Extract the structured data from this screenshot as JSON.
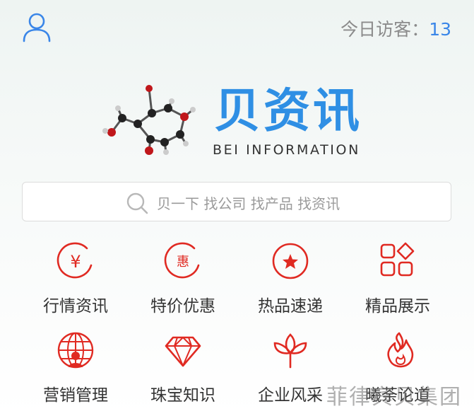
{
  "header": {
    "visitor_label": "今日访客：",
    "visitor_count": "13",
    "user_icon": "user-icon"
  },
  "logo": {
    "title_cn": "贝资讯",
    "title_en": "BEI INFORMATION",
    "image": "molecule-logo"
  },
  "search": {
    "placeholder": "贝一下 找公司 找产品 找资讯",
    "icon": "search-icon"
  },
  "menu": [
    {
      "label": "行情资讯",
      "icon": "yen-circle-icon"
    },
    {
      "label": "特价优惠",
      "icon": "discount-circle-icon"
    },
    {
      "label": "热品速递",
      "icon": "star-circle-icon"
    },
    {
      "label": "精品展示",
      "icon": "grid-diamond-icon"
    },
    {
      "label": "营销管理",
      "icon": "globe-user-icon"
    },
    {
      "label": "珠宝知识",
      "icon": "diamond-icon"
    },
    {
      "label": "企业风采",
      "icon": "lotus-icon"
    },
    {
      "label": "曦荼论道",
      "icon": "flame-icon"
    }
  ],
  "watermark": "菲律宾贝集团",
  "colors": {
    "accent": "#3a86e8",
    "brand": "#2f8fe4",
    "icon_red": "#e02a22"
  }
}
